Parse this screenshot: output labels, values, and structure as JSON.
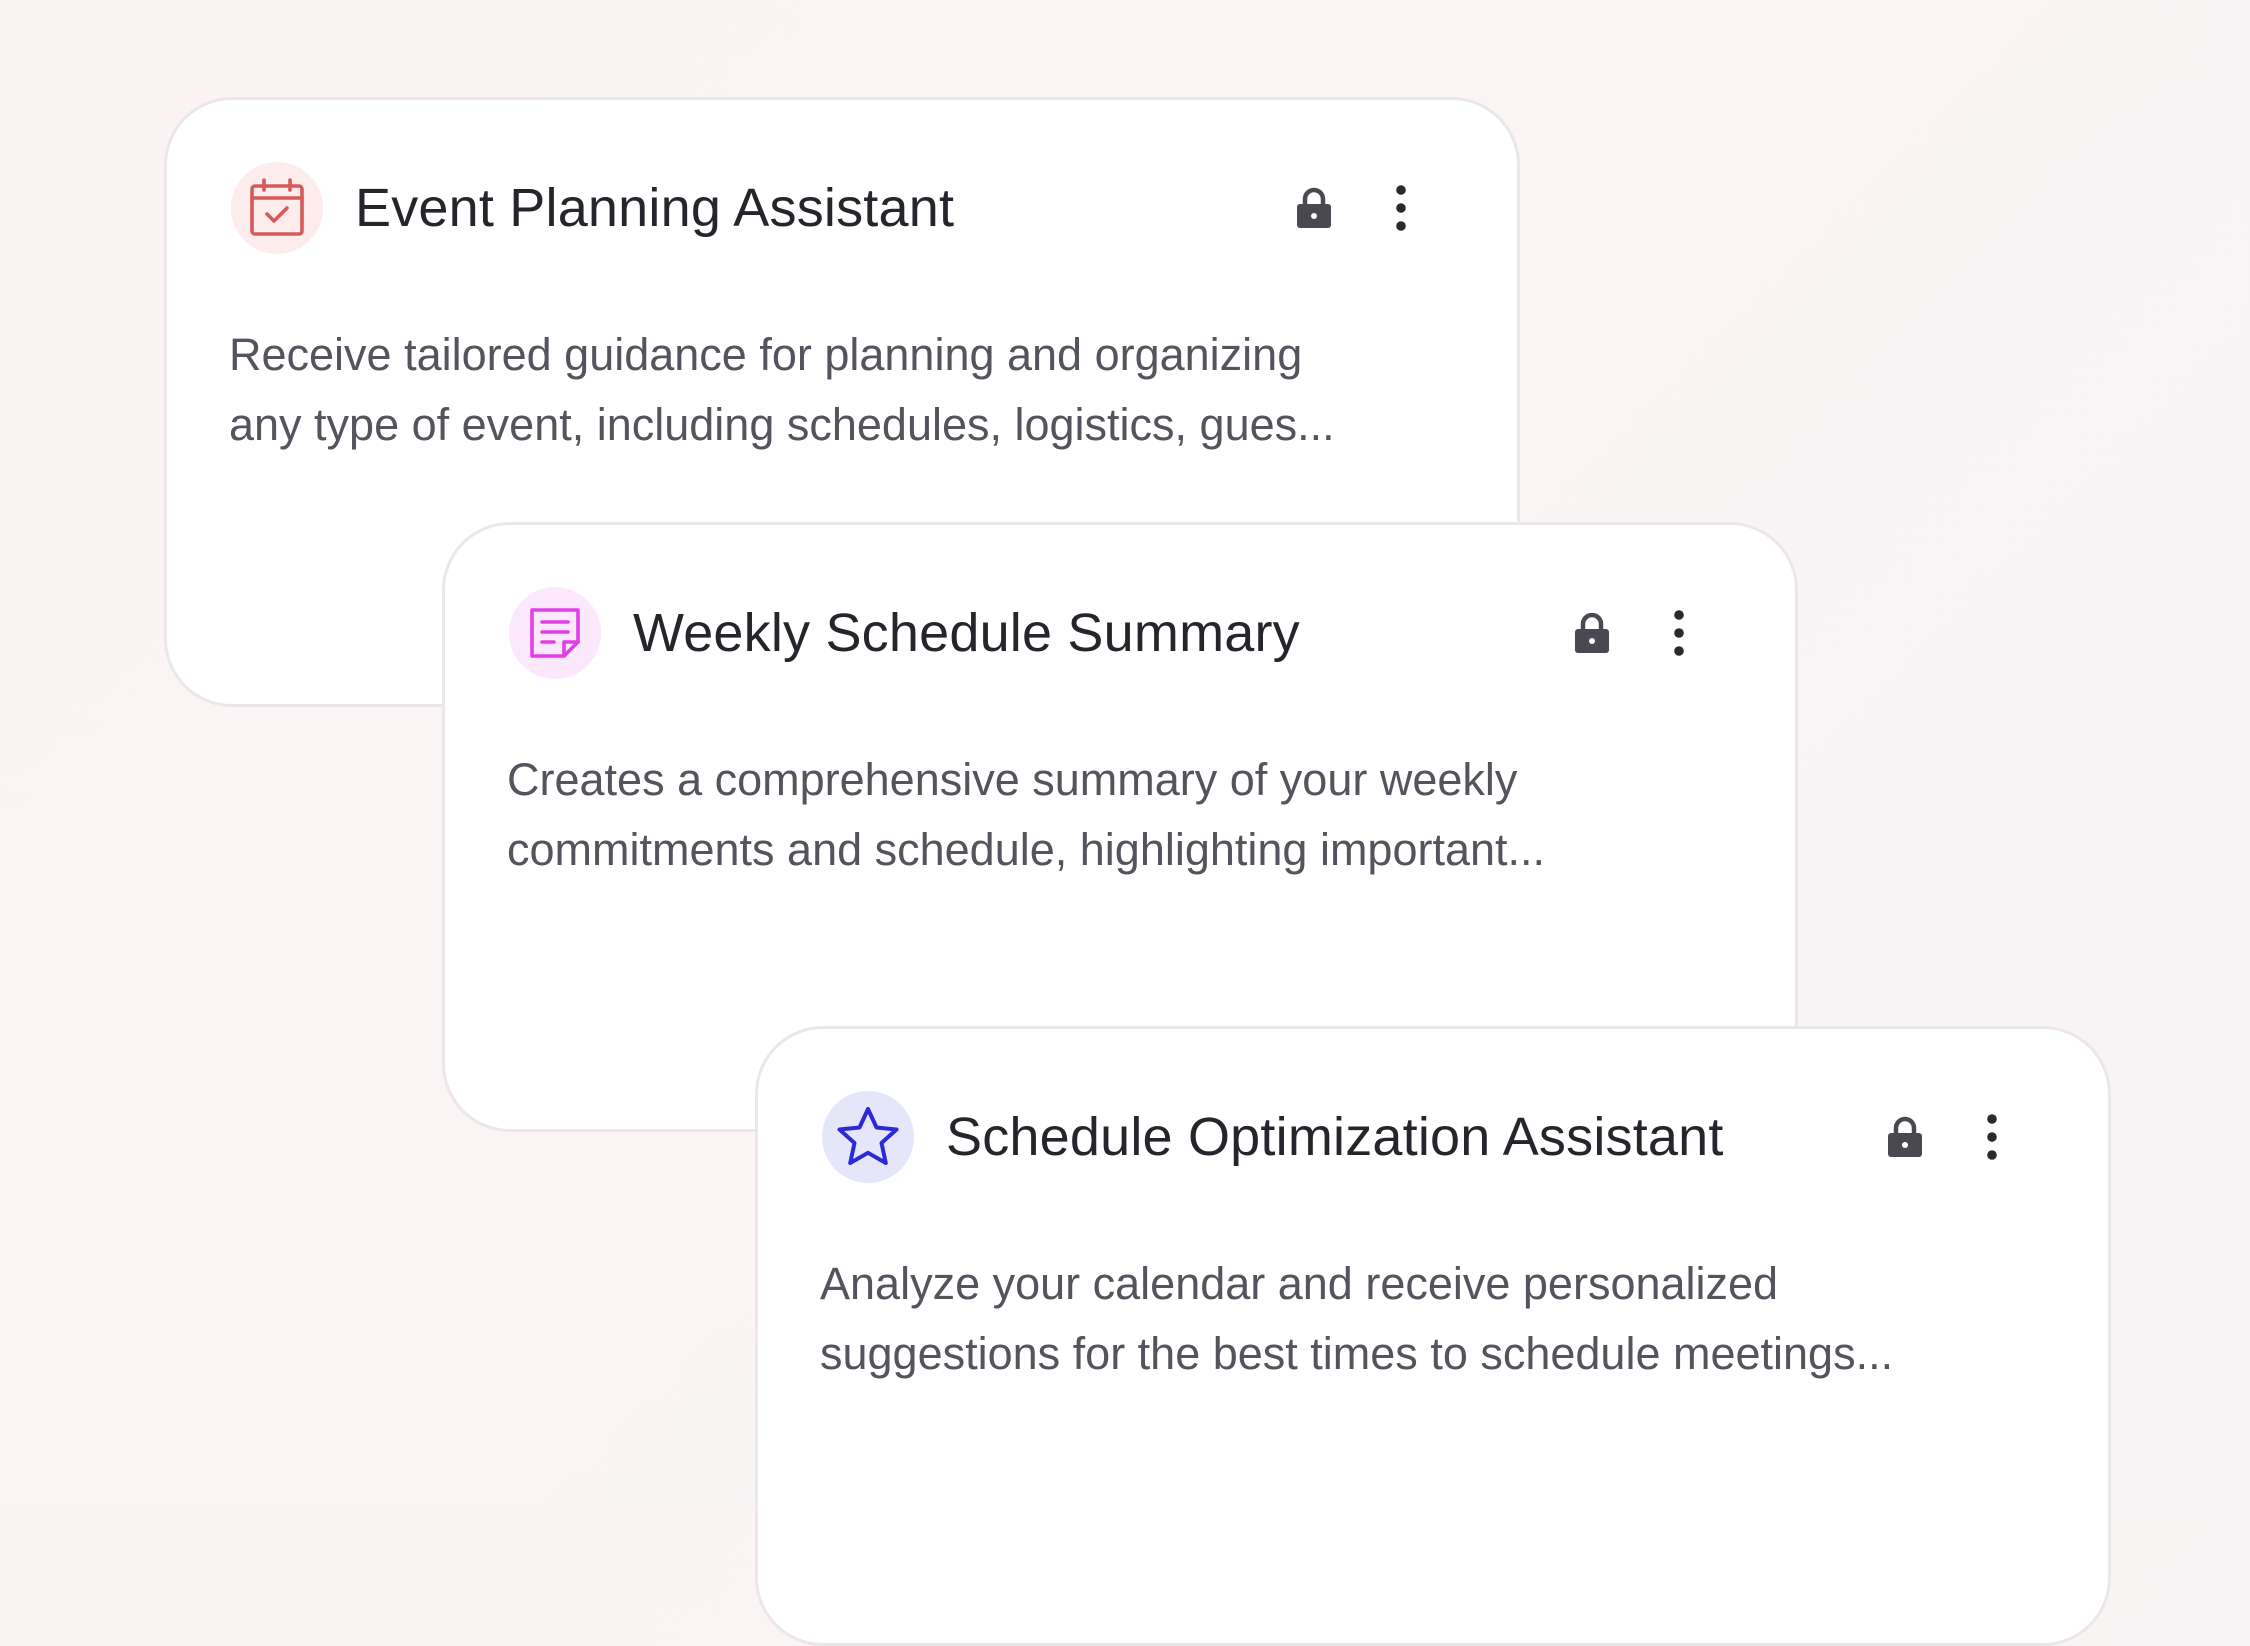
{
  "cards": [
    {
      "title": "Event Planning Assistant",
      "description": "Receive tailored guidance for planning and organizing\nany type of event, including schedules, logistics, gues...",
      "icon": "calendar-check-icon",
      "icon_color": "#d65a5a",
      "icon_bg": "#fdecec",
      "locked": true
    },
    {
      "title": "Weekly Schedule Summary",
      "description": "Creates a comprehensive summary of your weekly\ncommitments and schedule, highlighting important...",
      "icon": "note-icon",
      "icon_color": "#e040e6",
      "icon_bg": "#fce8fd",
      "locked": true
    },
    {
      "title": "Schedule Optimization Assistant",
      "description": "Analyze your calendar and receive personalized\nsuggestions for the best times to schedule meetings...",
      "icon": "star-icon",
      "icon_color": "#2a2ad6",
      "icon_bg": "#e6e6fb",
      "locked": true
    }
  ],
  "colors": {
    "title": "#27252b",
    "description": "#55535c",
    "lock": "#4a4850",
    "menu": "#2b2930",
    "card_border": "#ebe6e8"
  }
}
